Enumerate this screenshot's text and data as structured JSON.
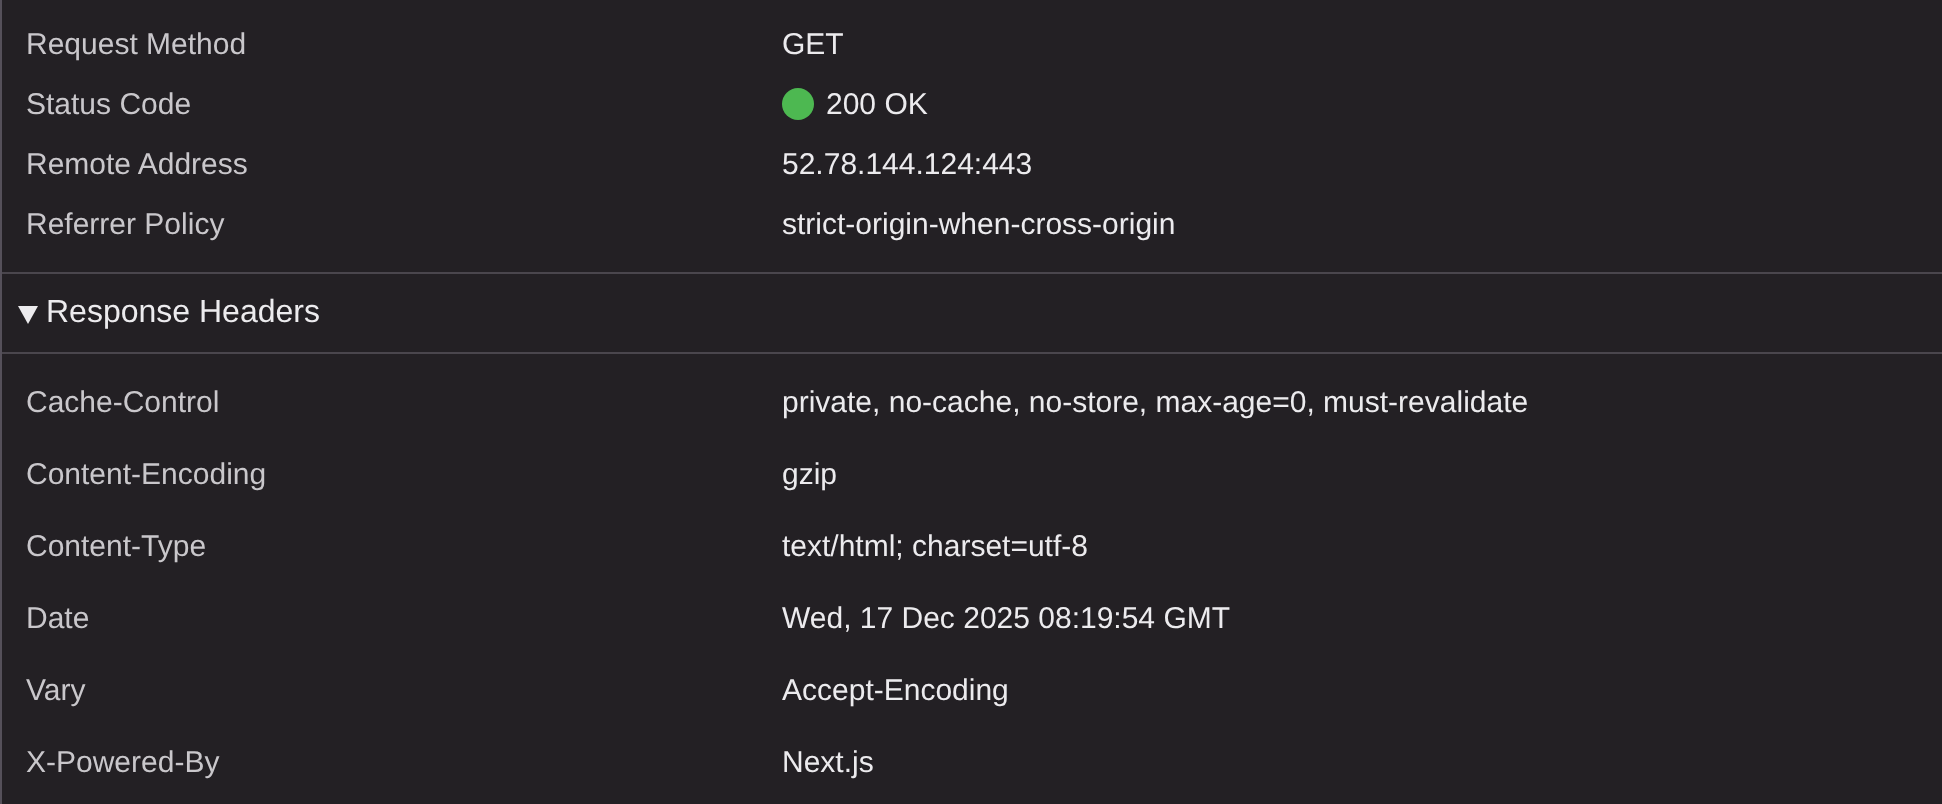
{
  "general_rows": [
    {
      "name": "Request Method",
      "value": "GET"
    },
    {
      "name": "Status Code",
      "value": "200 OK",
      "color": "#4db851"
    },
    {
      "name": "Remote Address",
      "value": "52.78.144.124:443"
    },
    {
      "name": "Referrer Policy",
      "value": "strict-origin-when-cross-origin"
    }
  ],
  "response_headers": {
    "title": "Response Headers",
    "expanded": true,
    "rows": [
      {
        "name": "Cache-Control",
        "value": "private, no-cache, no-store, max-age=0, must-revalidate"
      },
      {
        "name": "Content-Encoding",
        "value": "gzip"
      },
      {
        "name": "Content-Type",
        "value": "text/html; charset=utf-8"
      },
      {
        "name": "Date",
        "value": "Wed, 17 Dec 2025 08:19:54 GMT"
      },
      {
        "name": "Vary",
        "value": "Accept-Encoding"
      },
      {
        "name": "X-Powered-By",
        "value": "Next.js"
      }
    ]
  }
}
